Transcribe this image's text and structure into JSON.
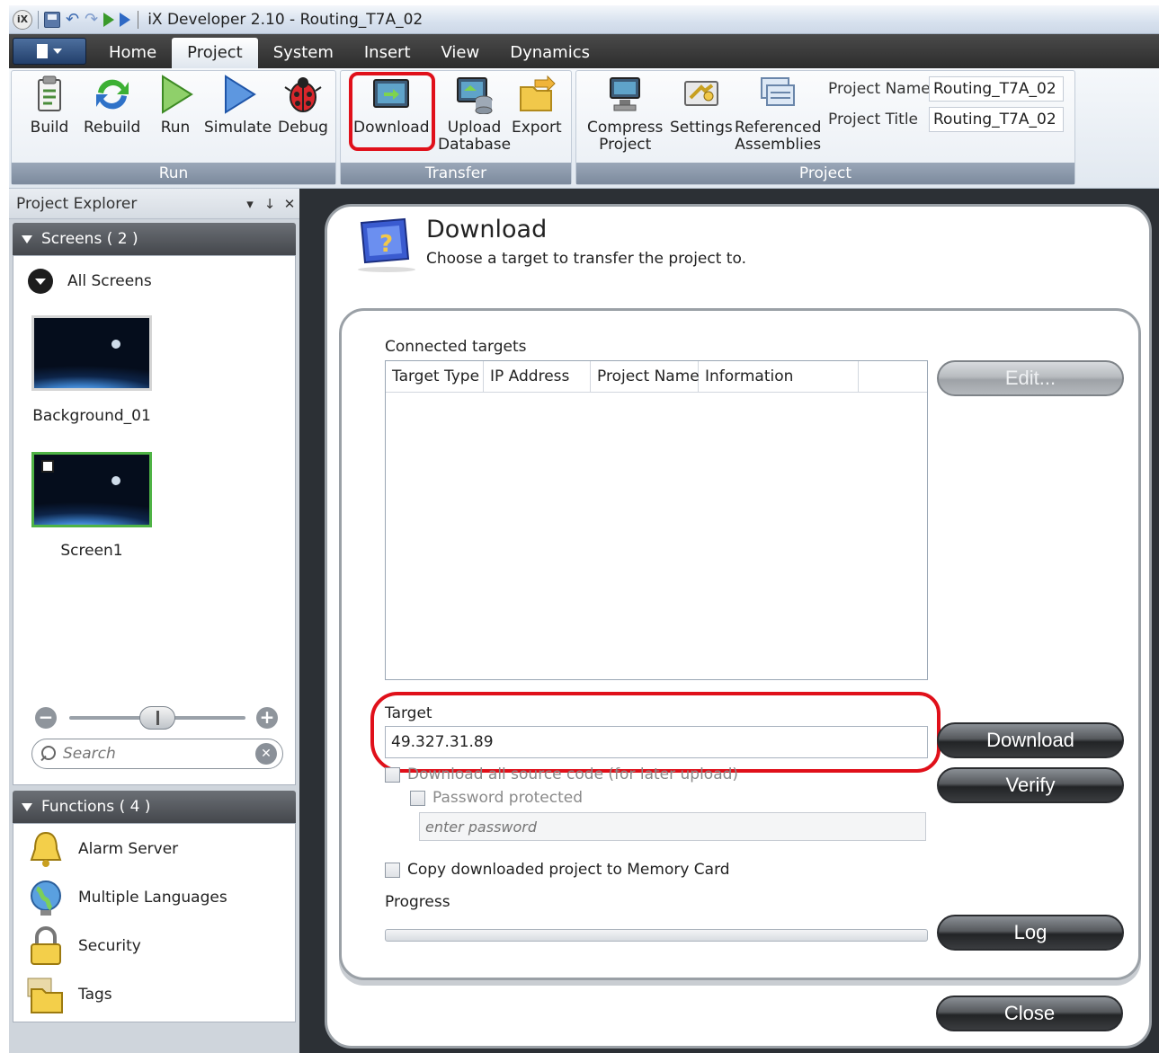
{
  "window": {
    "title": "iX Developer 2.10 - Routing_T7A_02",
    "logo": "iX"
  },
  "ribbon_tabs": [
    "Home",
    "Project",
    "System",
    "Insert",
    "View",
    "Dynamics"
  ],
  "active_tab": "Project",
  "groups": {
    "run": {
      "label": "Run",
      "buttons": [
        "Build",
        "Rebuild",
        "Run",
        "Simulate",
        "Debug"
      ]
    },
    "transfer": {
      "label": "Transfer",
      "download": "Download",
      "upload_l1": "Upload",
      "upload_l2": "Database",
      "export": "Export"
    },
    "project": {
      "label": "Project",
      "compress_l1": "Compress",
      "compress_l2": "Project",
      "settings": "Settings",
      "ref_l1": "Referenced",
      "ref_l2": "Assemblies",
      "name_label": "Project Name",
      "name_value": "Routing_T7A_02",
      "title_label": "Project Title",
      "title_value": "Routing_T7A_02"
    }
  },
  "project_explorer": {
    "title": "Project Explorer",
    "pin": "↓",
    "close": "✕",
    "screens_header": "Screens ( 2 )",
    "all_screens": "All Screens",
    "screens": [
      "Background_01",
      "Screen1"
    ],
    "zoom_level": 0.5,
    "search_placeholder": "Search",
    "functions_header": "Functions ( 4 )",
    "functions": [
      "Alarm Server",
      "Multiple Languages",
      "Security",
      "Tags"
    ]
  },
  "dialog": {
    "title": "Download",
    "subtitle": "Choose a target to transfer the project to.",
    "connected_targets_label": "Connected targets",
    "columns": [
      "Target Type",
      "IP Address",
      "Project Name",
      "Information"
    ],
    "target_label": "Target",
    "target_value": "49.327.31.89",
    "download_source": "Download all source code (for later upload)",
    "password_protected": "Password protected",
    "password_placeholder": "enter password",
    "memory_card": "Copy downloaded project to Memory Card",
    "progress_label": "Progress",
    "progress_value": 0,
    "buttons": {
      "edit": "Edit...",
      "download": "Download",
      "verify": "Verify",
      "log": "Log",
      "close": "Close"
    }
  },
  "colors": {
    "highlight": "#e0101a",
    "selected_screen": "#4fb345"
  }
}
